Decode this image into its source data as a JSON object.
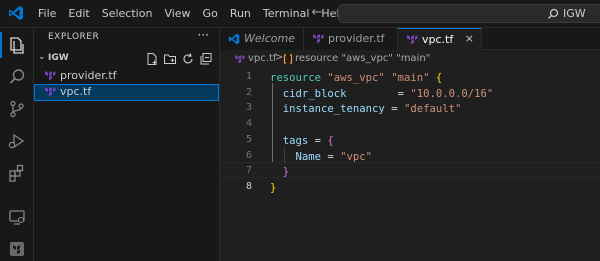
{
  "colors": {
    "accent": "#0078d4",
    "terraform": "#7b42bc",
    "keyword": "#4ec9b0",
    "string": "#ce9178",
    "attribute": "#9cdcfe",
    "bracket_outer": "#ffd700",
    "bracket_inner": "#da70d6"
  },
  "menu": [
    "File",
    "Edit",
    "Selection",
    "View",
    "Go",
    "Run",
    "Terminal",
    "Help"
  ],
  "nav": {
    "back_icon": "arrow-left-icon",
    "forward_icon": "arrow-right-icon"
  },
  "command_center": {
    "text": "IGW",
    "icon": "search-icon"
  },
  "activity_bar": [
    {
      "name": "explorer-icon",
      "active": true
    },
    {
      "name": "search-icon",
      "active": false
    },
    {
      "name": "source-control-icon",
      "active": false
    },
    {
      "name": "run-debug-icon",
      "active": false
    },
    {
      "name": "extensions-icon",
      "active": false
    },
    {
      "name": "remote-explorer-icon",
      "active": false
    },
    {
      "name": "terraform-icon",
      "active": false
    }
  ],
  "sidebar": {
    "title": "EXPLORER",
    "more": "···",
    "folder": {
      "name": "IGW",
      "expanded": true
    },
    "folder_actions": [
      "new-file-icon",
      "new-folder-icon",
      "refresh-icon",
      "collapse-all-icon"
    ],
    "files": [
      {
        "name": "provider.tf",
        "selected": false
      },
      {
        "name": "vpc.tf",
        "selected": true
      }
    ]
  },
  "tabs": [
    {
      "label": "Welcome",
      "icon": "vscode-icon",
      "active": false,
      "italic": true
    },
    {
      "label": "provider.tf",
      "icon": "terraform-file-icon",
      "active": false,
      "italic": false
    },
    {
      "label": "vpc.tf",
      "icon": "terraform-file-icon",
      "active": true,
      "italic": false,
      "close": "×"
    }
  ],
  "breadcrumb": {
    "file": "vpc.tf",
    "separator": ">",
    "symbol": "resource \"aws_vpc\" \"main\""
  },
  "editor": {
    "current_line": 8,
    "lines": [
      {
        "n": "1",
        "parts": [
          [
            "kw",
            "resource "
          ],
          [
            "str",
            "\"aws_vpc\" "
          ],
          [
            "str",
            "\"main\" "
          ],
          [
            "b1",
            "{"
          ]
        ]
      },
      {
        "n": "2",
        "parts": [
          [
            "attr",
            "  cidr_block"
          ],
          [
            "op",
            "        = "
          ],
          [
            "str",
            "\"10.0.0.0/16\""
          ]
        ]
      },
      {
        "n": "3",
        "parts": [
          [
            "attr",
            "  instance_tenancy"
          ],
          [
            "op",
            " = "
          ],
          [
            "str",
            "\"default\""
          ]
        ]
      },
      {
        "n": "4",
        "parts": []
      },
      {
        "n": "5",
        "parts": [
          [
            "attr",
            "  tags"
          ],
          [
            "op",
            " = "
          ],
          [
            "b2",
            "{"
          ]
        ]
      },
      {
        "n": "6",
        "parts": [
          [
            "attr",
            "    Name"
          ],
          [
            "op",
            " = "
          ],
          [
            "str",
            "\"vpc\""
          ]
        ]
      },
      {
        "n": "7",
        "parts": [
          [
            "b2",
            "  }"
          ]
        ]
      },
      {
        "n": "8",
        "parts": [
          [
            "b1",
            "}"
          ]
        ]
      }
    ]
  }
}
